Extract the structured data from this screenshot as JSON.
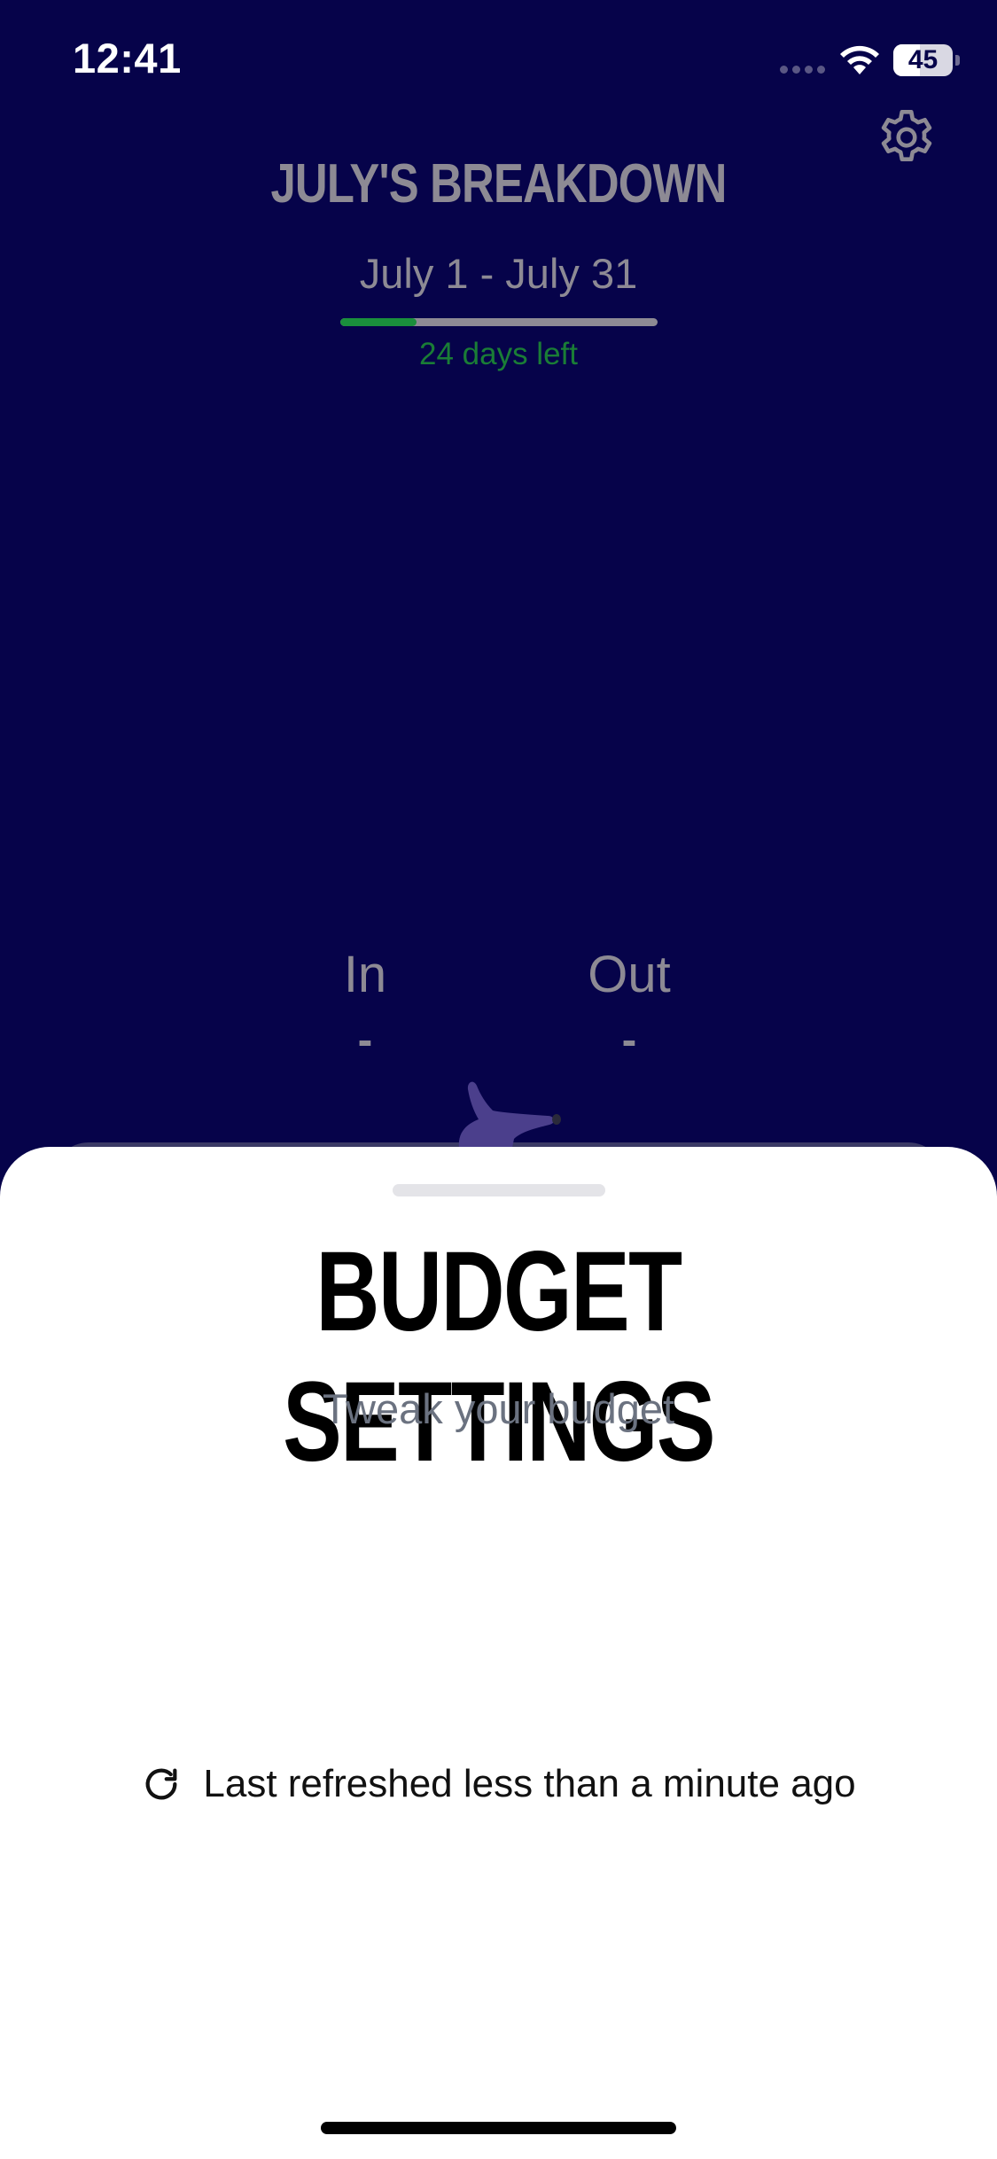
{
  "status_bar": {
    "time": "12:41",
    "battery_percent": "45",
    "battery_level": 0.45
  },
  "header": {
    "title": "JULY'S BREAKDOWN",
    "date_range": "July 1 - July 31",
    "period_progress": 0.24,
    "days_left": "24 days left"
  },
  "summary": {
    "in_label": "In",
    "in_value": "-",
    "out_label": "Out",
    "out_value": "-"
  },
  "sheet": {
    "title": "BUDGET SETTINGS",
    "subtitle": "Tweak your budget",
    "refresh_text": "Last refreshed less than a minute ago"
  },
  "colors": {
    "background": "#06034a",
    "accent_green": "#1a8f3c",
    "muted_text": "#8d8a94",
    "sheet_background": "#ffffff"
  },
  "icons": {
    "settings": "gear-icon",
    "refresh": "refresh-icon",
    "wifi": "wifi-icon",
    "battery": "battery-icon"
  }
}
